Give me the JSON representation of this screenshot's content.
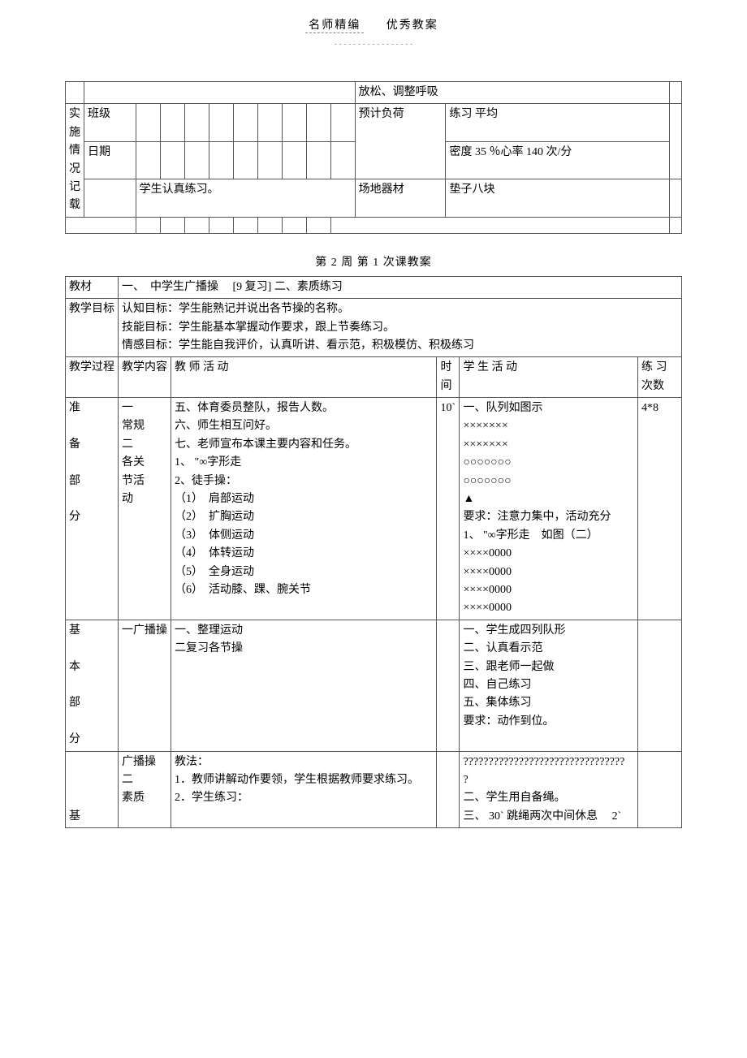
{
  "header": {
    "title_left": "名师精编",
    "title_right": "优秀教案",
    "dashes": "- - - - - - - - - - - - - - - - -"
  },
  "top_table": {
    "relax_text": "放松、调整呼吸",
    "impl_label": "实施情况记载",
    "class_label": "班级",
    "date_label": "日期",
    "forecast_label": "预计负荷",
    "density_line1": "练习   平均",
    "density_line2": "密度  35 ％心率  140  次/分",
    "student_note": "学生认真练习。",
    "venue_label": "场地器材",
    "venue_value": "垫子八块"
  },
  "lesson_title": "第  2 周   第 1 次课教案",
  "lesson2": {
    "jiaocai_label": "教材",
    "jiaocai_value": "一、　中学生广播操　 [9 复习]   二、素质练习",
    "goals_label": "教学目标",
    "goals_l1": "认知目标：学生能熟记并说出各节操的名称。",
    "goals_l2": "技能目标：学生能基本掌握动作要求，跟上节奏练习。",
    "goals_l3": "情感目标：学生能自我评价，认真听讲、看示范，积极模仿、积极练习",
    "hdr_process": "教学过程",
    "hdr_content": "教学内容",
    "hdr_teacher": "教  师  活  动",
    "hdr_time": "时间",
    "hdr_student": "学  生  活  动",
    "hdr_reps": "练 习 次数",
    "prep_label": "准\n\n备\n\n部\n\n分",
    "prep_content": "一\n常规\n二\n各关\n节活\n动",
    "prep_teacher": "五、体育委员整队，报告人数。\n六、师生相互问好。\n七、老师宣布本课主要内容和任务。\n1、 \"∞字形走\n2、徒手操：\n（1）　肩部运动\n（2）　扩胸运动\n（3）　体侧运动\n（4）　体转运动\n（5）　全身运动\n（6）　活动膝、踝、腕关节\n",
    "prep_time": "10`",
    "prep_student": "一、队列如图示\n×××××××\n×××××××\n○○○○○○○\n○○○○○○○\n▲\n要求：注意力集中，活动充分\n1、 \"∞字形走　如图（二）\n××××0000\n××××0000\n××××0000\n××××0000\n",
    "prep_reps": "4*8",
    "basic_label": "基\n\n本\n\n部\n\n分",
    "basic_content": "一广播操",
    "basic_teacher": "一、整理运动\n二复习各节操",
    "basic_student": "一、学生成四列队形\n二、认真看示范\n三、跟老师一起做\n四、自己练习\n五、集体练习\n要求：动作到位。",
    "basic2_label_start": "基",
    "basic2_content": "广播操\n二\n素质",
    "basic2_teacher": "教法：\n1．教师讲解动作要领，学生根据教师要求练习。\n2．学生练习：",
    "basic2_student": "????????????????????????????????\n?\n二、学生用自备绳。\n三、 30` 跳绳两次中间休息　 2`"
  }
}
